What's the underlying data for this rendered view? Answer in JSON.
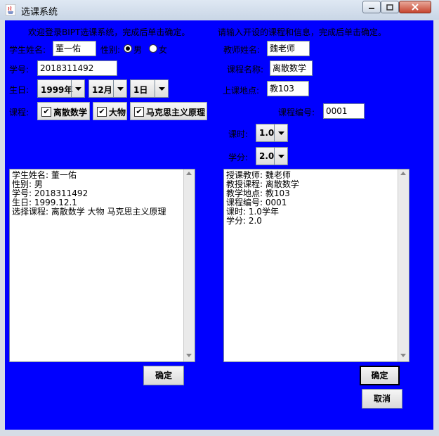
{
  "window": {
    "title": "选课系统"
  },
  "student": {
    "welcome": "欢迎登录BIPT选课系统，完成后单击确定。",
    "name_label": "学生姓名:",
    "name_value": "董一佑",
    "gender_label": "性别:",
    "gender_options": [
      "男",
      "女"
    ],
    "id_label": "学号:",
    "id_value": "2018311492",
    "birthday_label": "生日:",
    "year": "1999年",
    "month": "12月",
    "day": "1日",
    "courses_label": "课程:",
    "courses": [
      "离散数学",
      "大物",
      "马克思主义原理"
    ],
    "output_lines": [
      "学生姓名: 董一佑",
      "性别: 男",
      "学号: 2018311492",
      "生日: 1999.12.1",
      "选择课程: 离散数学 大物 马克思主义原理"
    ],
    "ok_button": "确定"
  },
  "teacher": {
    "prompt": "请输入开设的课程和信息，完成后单击确定。",
    "name_label": "教师姓名:",
    "name_value": "魏老师",
    "course_label": "课程名称:",
    "course_value": "离散数学",
    "place_label": "上课地点:",
    "place_value": "教103",
    "code_label": "课程编号:",
    "code_value": "0001",
    "hours_label": "课时:",
    "hours_value": "1.0",
    "credit_label": "学分:",
    "credit_value": "2.0",
    "output_lines": [
      "授课教师: 魏老师",
      "教授课程: 离散数学",
      "教学地点: 教103",
      "课程编号: 0001",
      "课时: 1.0学年",
      "学分: 2.0"
    ],
    "ok_button": "确定",
    "cancel_button": "取消"
  },
  "colors": {
    "panel_background": "#0000ff"
  }
}
